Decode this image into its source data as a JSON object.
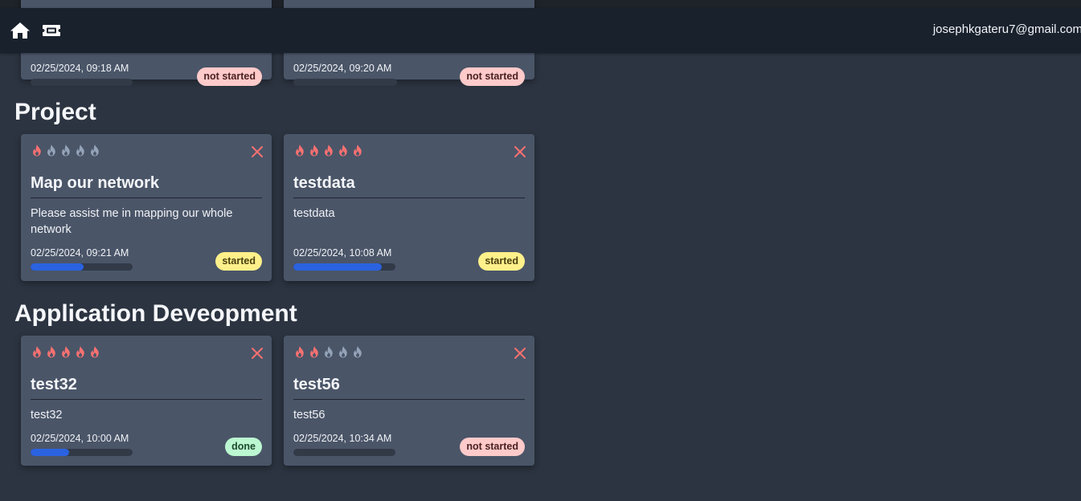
{
  "navbar": {
    "home_icon": "home-icon",
    "ticket_icon": "ticket-icon",
    "user_email": "josephkgateru7@gmail.com"
  },
  "colors": {
    "flame_active": "#f87171",
    "flame_inactive": "#94a3b8",
    "close": "#f87171",
    "progress": "#2a62e0"
  },
  "top_cards": [
    {
      "date": "02/25/2024, 09:18 AM",
      "status": "not started",
      "status_key": "not-started",
      "progress": 0
    },
    {
      "date": "02/25/2024, 09:20 AM",
      "status": "not started",
      "status_key": "not-started",
      "progress": 0
    }
  ],
  "sections": [
    {
      "title": "Project",
      "cards": [
        {
          "priority": 1,
          "title": "Map our network",
          "description": "Please assist me in mapping our whole network",
          "date": "02/25/2024, 09:21 AM",
          "status": "started",
          "status_key": "started",
          "progress": 0.52
        },
        {
          "priority": 5,
          "title": "testdata",
          "description": "testdata",
          "date": "02/25/2024, 10:08 AM",
          "status": "started",
          "status_key": "started",
          "progress": 0.87
        }
      ]
    },
    {
      "title": "Application Deveopment",
      "cards": [
        {
          "priority": 5,
          "title": "test32",
          "description": "test32",
          "date": "02/25/2024, 10:00 AM",
          "status": "done",
          "status_key": "done",
          "progress": 0.38
        },
        {
          "priority": 2,
          "title": "test56",
          "description": "test56",
          "date": "02/25/2024, 10:34 AM",
          "status": "not started",
          "status_key": "not-started",
          "progress": 0
        }
      ]
    }
  ]
}
